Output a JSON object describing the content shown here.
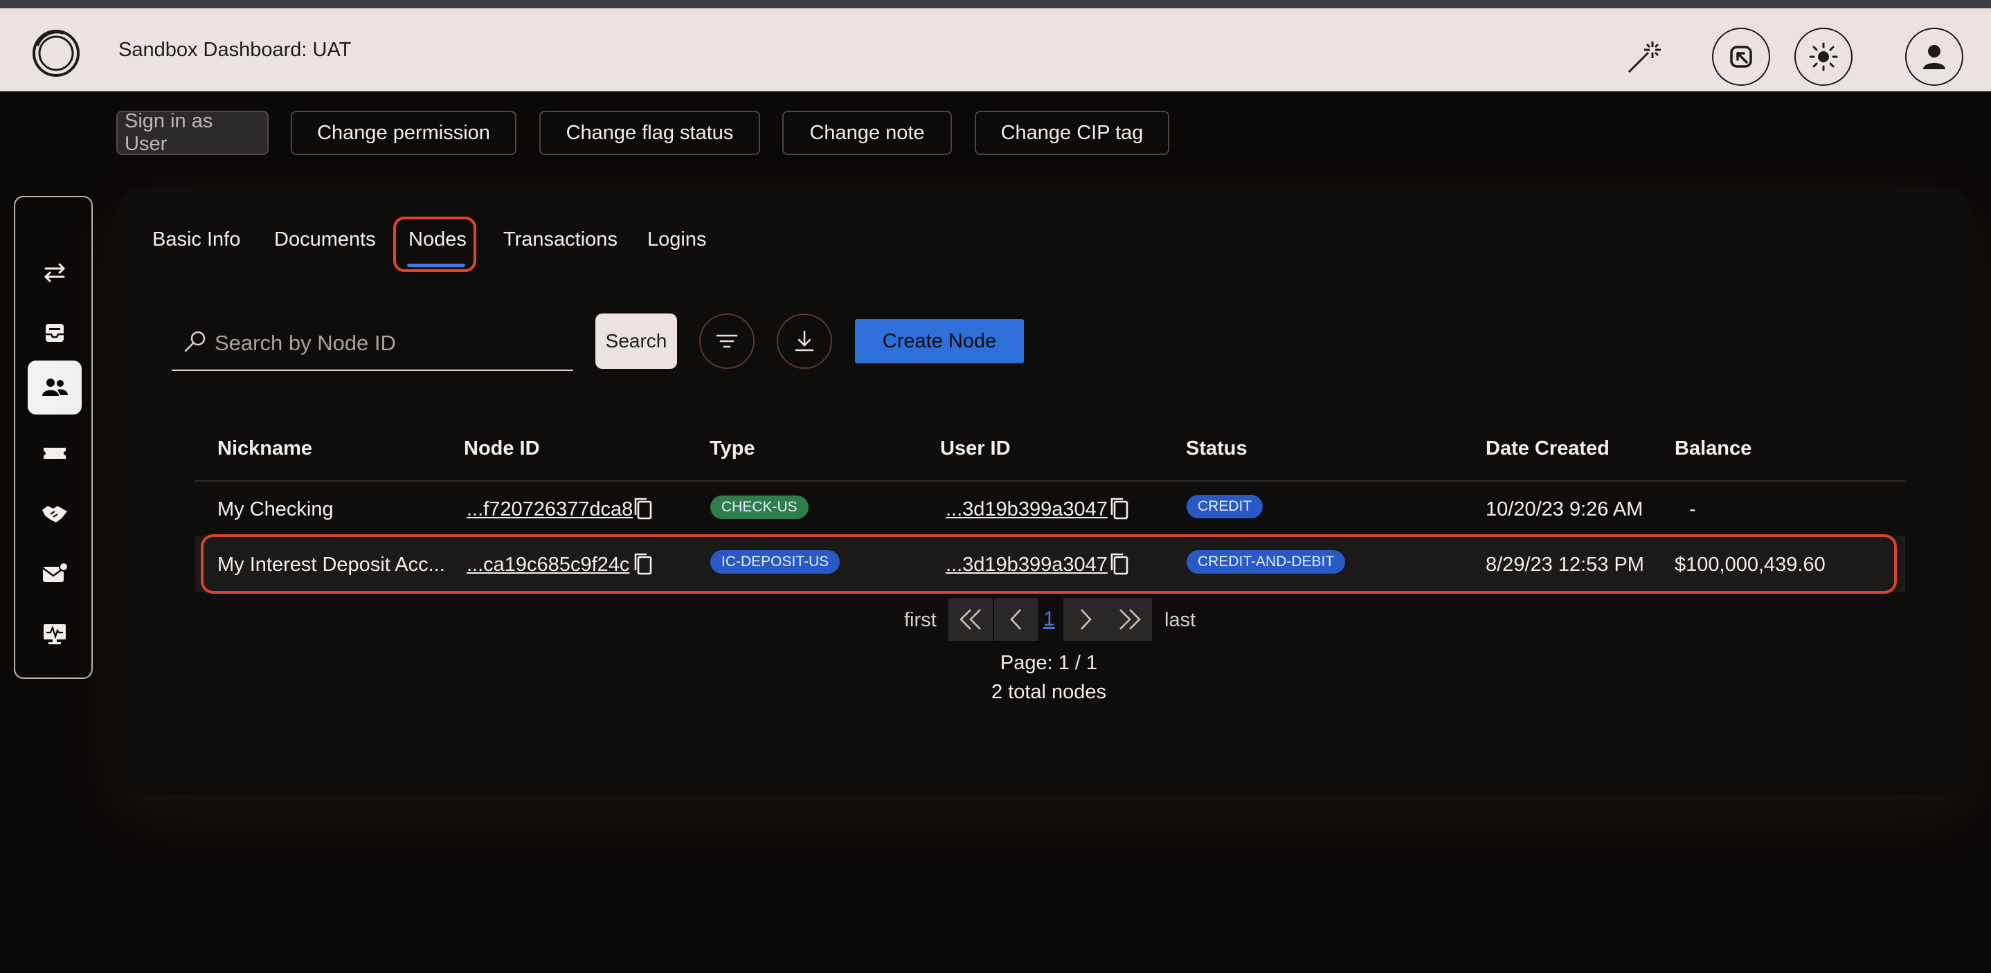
{
  "header": {
    "title": "Sandbox Dashboard: UAT",
    "icons": [
      "logo-icon",
      "magic-wand-icon",
      "exit-arrow-icon",
      "sun-icon",
      "user-icon"
    ]
  },
  "actions": {
    "sign_in": "Sign in as User",
    "change_permission": "Change permission",
    "change_flag": "Change flag status",
    "change_note": "Change note",
    "change_cip": "Change CIP tag"
  },
  "sidebar": {
    "items": [
      "transfer-icon",
      "inbox-icon",
      "users-icon",
      "ticket-icon",
      "handshake-icon",
      "mail-icon",
      "monitor-icon"
    ],
    "active": "users-icon"
  },
  "tabs": [
    "Basic Info",
    "Documents",
    "Nodes",
    "Transactions",
    "Logins"
  ],
  "active_tab": "Nodes",
  "search": {
    "placeholder": "Search by Node ID",
    "button": "Search",
    "create_button": "Create Node"
  },
  "table": {
    "headers": [
      "Nickname",
      "Node ID",
      "Type",
      "User ID",
      "Status",
      "Date Created",
      "Balance"
    ],
    "rows": [
      {
        "nickname": "My Checking",
        "node_id": "...f720726377dca8",
        "type": "CHECK-US",
        "user_id": "...3d19b399a3047",
        "status": "CREDIT",
        "date": "10/20/23 9:26 AM",
        "balance": "-"
      },
      {
        "nickname": "My Interest Deposit Acc...",
        "node_id": "...ca19c685c9f24c",
        "type": "IC-DEPOSIT-US",
        "user_id": "...3d19b399a3047",
        "status": "CREDIT-AND-DEBIT",
        "date": "8/29/23 12:53 PM",
        "balance": "$100,000,439.60"
      }
    ]
  },
  "pagination": {
    "first": "first",
    "last": "last",
    "current": "1",
    "page_text": "Page: 1 / 1",
    "total": "2 total nodes"
  },
  "colors": {
    "accent_blue": "#2e6fd9",
    "highlight_red": "#d8442d",
    "badge_green": "#2f7d4a",
    "badge_blue": "#2859c4"
  }
}
